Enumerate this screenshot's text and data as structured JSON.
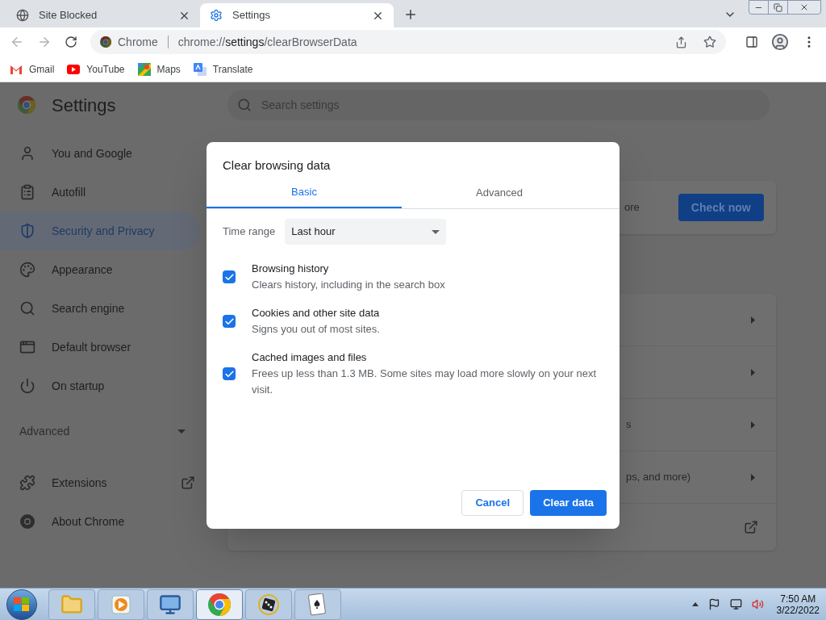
{
  "browser_tabs": [
    {
      "title": "Site Blocked",
      "kind": "globe",
      "selected": false
    },
    {
      "title": "Settings",
      "kind": "gear",
      "selected": true
    }
  ],
  "address_bar": {
    "origin": "Chrome",
    "url_scheme": "chrome://",
    "url_host": "settings",
    "url_path": "/clearBrowserData"
  },
  "bookmarks": [
    {
      "label": "Gmail",
      "kind": "gmail"
    },
    {
      "label": "YouTube",
      "kind": "youtube"
    },
    {
      "label": "Maps",
      "kind": "maps"
    },
    {
      "label": "Translate",
      "kind": "translate"
    }
  ],
  "settings": {
    "title": "Settings",
    "search_placeholder": "Search settings",
    "nav_items": [
      {
        "label": "You and Google",
        "kind": "person",
        "selected": false
      },
      {
        "label": "Autofill",
        "kind": "clipboard",
        "selected": false
      },
      {
        "label": "Security and Privacy",
        "kind": "shield",
        "selected": true
      },
      {
        "label": "Appearance",
        "kind": "palette",
        "selected": false
      },
      {
        "label": "Search engine",
        "kind": "search",
        "selected": false
      },
      {
        "label": "Default browser",
        "kind": "browser",
        "selected": false
      },
      {
        "label": "On startup",
        "kind": "power",
        "selected": false
      }
    ],
    "advanced_label": "Advanced",
    "extra_items": [
      {
        "label": "Extensions",
        "kind": "puzzle"
      },
      {
        "label": "About Chrome",
        "kind": "chrome"
      }
    ],
    "behind_dialog": {
      "card_1_text": "ore",
      "card_1_button": "Check now",
      "row_3_text": "s",
      "row_4_text": "ps, and more)"
    }
  },
  "dialog": {
    "title": "Clear browsing data",
    "tabs": [
      {
        "label": "Basic",
        "selected": true
      },
      {
        "label": "Advanced",
        "selected": false
      }
    ],
    "time_range_label": "Time range",
    "time_range_value": "Last hour",
    "items": [
      {
        "title": "Browsing history",
        "description": "Clears history, including in the search box",
        "checked": true
      },
      {
        "title": "Cookies and other site data",
        "description": "Signs you out of most sites.",
        "checked": true
      },
      {
        "title": "Cached images and files",
        "description": "Frees up less than 1.3 MB. Some sites may load more slowly on your next visit.",
        "checked": true
      }
    ],
    "cancel_button": "Cancel",
    "confirm_button": "Clear data"
  },
  "taskbar": {
    "apps": [
      {
        "kind": "folder",
        "selected": false
      },
      {
        "kind": "media",
        "selected": false
      },
      {
        "kind": "monitor",
        "selected": false
      },
      {
        "kind": "chrome",
        "selected": true
      },
      {
        "kind": "dice",
        "selected": false
      },
      {
        "kind": "cards",
        "selected": false
      }
    ],
    "time": "7:50 AM",
    "date": "3/22/2022"
  }
}
